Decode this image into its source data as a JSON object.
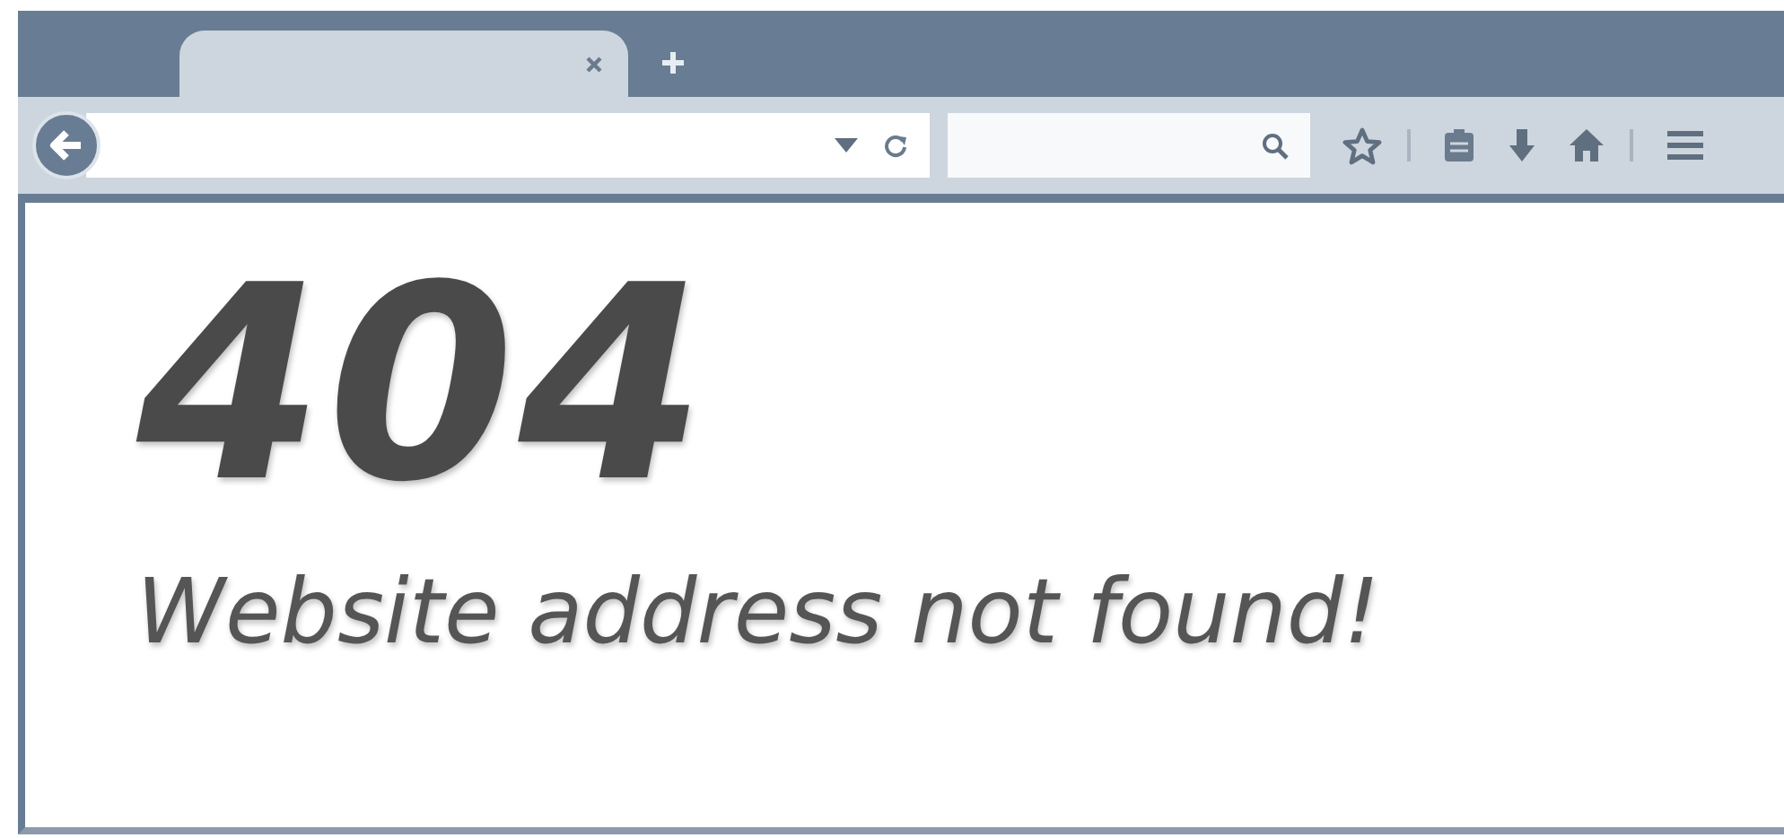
{
  "page": {
    "heading": "404",
    "message": "Website address not found!"
  }
}
